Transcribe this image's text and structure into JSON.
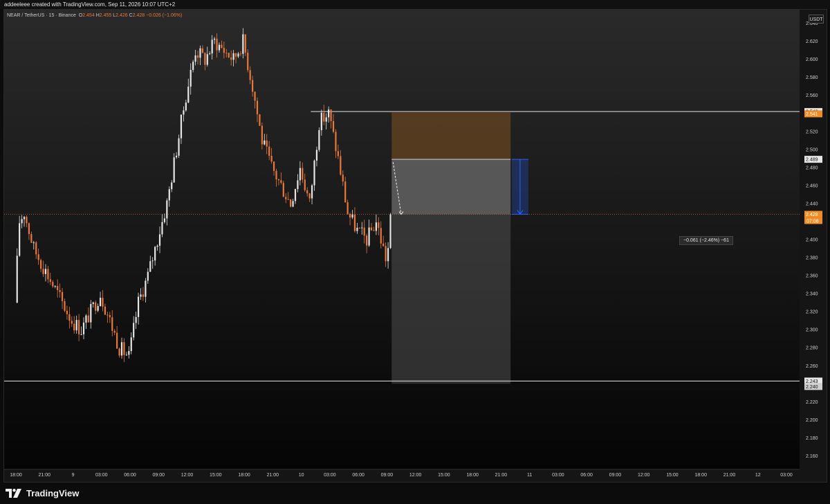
{
  "header": {
    "caption": "addeeleee created with TradingView.com, Sep 11, 2026 10:07 UTC+2"
  },
  "legend": {
    "symbol": "NEAR / TetherUS · 15 · Binance",
    "open_label": "O",
    "open": "2.454",
    "high_label": "H",
    "high": "2.455",
    "low_label": "L",
    "low": "2.426",
    "close_label": "C",
    "close": "2.428",
    "change": "−0.026 (−1.06%)"
  },
  "currency": "USDT",
  "footer": {
    "brand": "TradingView"
  },
  "measure": {
    "label": "−0.061 (−2.46%) −61"
  },
  "colors": {
    "up": "#e6e6e6",
    "down": "#e9783a",
    "background": "#151515",
    "zone_profit": "#5e4020",
    "zone_loss": "#5a5a5a"
  },
  "chart_data": {
    "type": "candlestick",
    "pair": "NEAR / TetherUS",
    "timeframe": "15",
    "exchange": "Binance",
    "ylim": [
      2.145,
      2.655
    ],
    "y_ticks": [
      "2.160",
      "2.180",
      "2.200",
      "2.220",
      "2.240",
      "2.260",
      "2.280",
      "2.300",
      "2.320",
      "2.340",
      "2.360",
      "2.380",
      "2.400",
      "2.420",
      "2.440",
      "2.460",
      "2.480",
      "2.500",
      "2.520",
      "2.540",
      "2.560",
      "2.580",
      "2.600",
      "2.620",
      "2.640"
    ],
    "x_ticks": [
      "18:00",
      "21:00",
      "9",
      "03:00",
      "06:00",
      "09:00",
      "12:00",
      "15:00",
      "18:00",
      "21:00",
      "10",
      "03:00",
      "06:00",
      "09:00",
      "12:00",
      "15:00",
      "18:00",
      "21:00",
      "11",
      "03:00",
      "06:00",
      "09:00",
      "12:00",
      "15:00",
      "18:00",
      "21:00",
      "12",
      "03:00"
    ],
    "x_tick_hours": [
      0,
      3,
      6,
      9,
      12,
      15,
      18,
      21,
      24,
      27,
      30,
      33,
      36,
      39,
      42,
      45,
      48,
      51,
      54,
      57,
      60,
      63,
      66,
      69,
      72,
      75,
      78,
      81
    ],
    "last_candle_hour": 39.5,
    "price_path": [
      [
        0,
        2.33
      ],
      [
        0.5,
        2.42
      ],
      [
        1,
        2.43
      ],
      [
        2,
        2.39
      ],
      [
        3,
        2.37
      ],
      [
        4,
        2.35
      ],
      [
        5,
        2.33
      ],
      [
        6,
        2.31
      ],
      [
        7,
        2.3
      ],
      [
        8,
        2.32
      ],
      [
        9,
        2.34
      ],
      [
        10,
        2.31
      ],
      [
        11,
        2.28
      ],
      [
        12,
        2.27
      ],
      [
        13,
        2.33
      ],
      [
        14,
        2.36
      ],
      [
        15,
        2.4
      ],
      [
        16,
        2.44
      ],
      [
        17,
        2.5
      ],
      [
        18,
        2.56
      ],
      [
        19,
        2.61
      ],
      [
        20,
        2.6
      ],
      [
        21,
        2.62
      ],
      [
        22,
        2.61
      ],
      [
        23,
        2.6
      ],
      [
        24,
        2.62
      ],
      [
        25,
        2.57
      ],
      [
        26,
        2.51
      ],
      [
        27,
        2.48
      ],
      [
        28,
        2.46
      ],
      [
        29,
        2.44
      ],
      [
        30,
        2.48
      ],
      [
        31,
        2.44
      ],
      [
        32,
        2.53
      ],
      [
        33,
        2.54
      ],
      [
        34,
        2.49
      ],
      [
        35,
        2.43
      ],
      [
        36,
        2.41
      ],
      [
        37,
        2.4
      ],
      [
        38,
        2.42
      ],
      [
        39,
        2.38
      ],
      [
        40,
        2.42
      ],
      [
        41,
        2.44
      ],
      [
        42,
        2.46
      ],
      [
        43,
        2.5
      ],
      [
        44,
        2.5
      ],
      [
        45,
        2.52
      ],
      [
        46,
        2.53
      ],
      [
        47,
        2.52
      ],
      [
        48,
        2.47
      ],
      [
        49,
        2.46
      ],
      [
        50,
        2.42
      ],
      [
        51,
        2.38
      ],
      [
        52,
        2.42
      ],
      [
        53,
        2.46
      ],
      [
        54,
        2.49
      ],
      [
        55,
        2.5
      ],
      [
        56,
        2.46
      ],
      [
        57,
        2.44
      ]
    ],
    "last_price": 2.428,
    "countdown": "07:08",
    "horizontal_lines": [
      {
        "price": 2.542,
        "label": "2.542"
      },
      {
        "price": 2.243,
        "label": "2.243"
      }
    ],
    "axis_badges": [
      {
        "price": 2.542,
        "label": "2.542",
        "style": "white"
      },
      {
        "price": 2.541,
        "label": "2.541",
        "style": "orange"
      },
      {
        "price": 2.489,
        "label": "2.489",
        "style": "white"
      },
      {
        "price": 2.428,
        "label": "2.428",
        "style": "orange"
      },
      {
        "price": 2.243,
        "label": "2.243",
        "style": "white"
      },
      {
        "price": 2.24,
        "label": "2.240",
        "style": "grey"
      }
    ],
    "position": {
      "type": "short",
      "entry": 2.489,
      "stop": 2.541,
      "target": 2.24,
      "start_hour": 39.5,
      "end_hour": 52
    },
    "measure": {
      "from": 2.489,
      "to": 2.428,
      "change": -0.061,
      "change_pct": -2.46,
      "ticks": -61,
      "at_hour": 53
    }
  }
}
